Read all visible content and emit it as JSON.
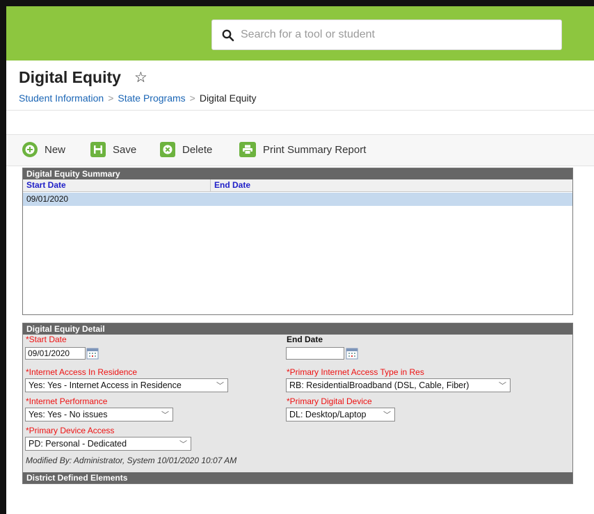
{
  "search": {
    "placeholder": "Search for a tool or student"
  },
  "page": {
    "title": "Digital Equity"
  },
  "breadcrumb": {
    "items": [
      "Student Information",
      "State Programs",
      "Digital Equity"
    ]
  },
  "toolbar": {
    "new_label": "New",
    "save_label": "Save",
    "delete_label": "Delete",
    "print_label": "Print Summary Report"
  },
  "summary": {
    "title": "Digital Equity Summary",
    "columns": [
      "Start Date",
      "End Date"
    ],
    "rows": [
      {
        "start": "09/01/2020",
        "end": ""
      }
    ]
  },
  "detail": {
    "title": "Digital Equity Detail",
    "start_date_label": "*Start Date",
    "start_date_value": "09/01/2020",
    "end_date_label": "End Date",
    "end_date_value": "",
    "internet_access_label": "*Internet Access In Residence",
    "internet_access_value": "Yes: Yes - Internet Access in Residence",
    "access_type_label": "*Primary Internet Access Type in Res",
    "access_type_value": "RB: ResidentialBroadband (DSL, Cable, Fiber)",
    "performance_label": "*Internet Performance",
    "performance_value": "Yes: Yes - No issues",
    "digital_device_label": "*Primary Digital Device",
    "digital_device_value": "DL: Desktop/Laptop",
    "device_access_label": "*Primary Device Access",
    "device_access_value": "PD: Personal - Dedicated",
    "modified_by": "Modified By: Administrator, System 10/01/2020 10:07 AM"
  },
  "district": {
    "title": "District Defined Elements"
  },
  "colors": {
    "topbar": "#8dc63f",
    "icon_green": "#6db33f",
    "link": "#1a65b5",
    "required": "#ee1111",
    "selected_row": "#c5d9ee"
  }
}
